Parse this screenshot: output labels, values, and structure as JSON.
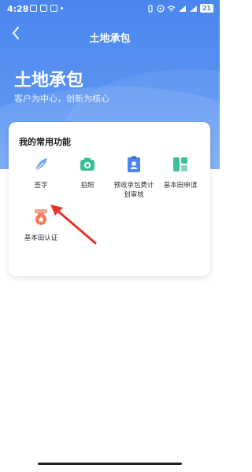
{
  "status_bar": {
    "time": "4:28",
    "battery": "21"
  },
  "navbar": {
    "back_symbol": "‹",
    "title": "土地承包"
  },
  "hero": {
    "title": "土地承包",
    "subtitle": "客户为中心，创新为核心"
  },
  "card": {
    "title": "我的常用功能",
    "functions": [
      {
        "label": "签字",
        "icon": "feather-icon",
        "color": "#7aa6e8"
      },
      {
        "label": "拍照",
        "icon": "camera-icon",
        "color": "#3dbf9a"
      },
      {
        "label": "预收承包费计划审核",
        "icon": "person-document-icon",
        "color": "#4a86ee"
      },
      {
        "label": "基本田申请",
        "icon": "grid-layout-icon",
        "color": "#3dbf9a"
      },
      {
        "label": "基本田认证",
        "icon": "medal-icon",
        "color": "#f07a5a"
      }
    ]
  },
  "annotation": {
    "arrow_color": "#e8322a"
  }
}
